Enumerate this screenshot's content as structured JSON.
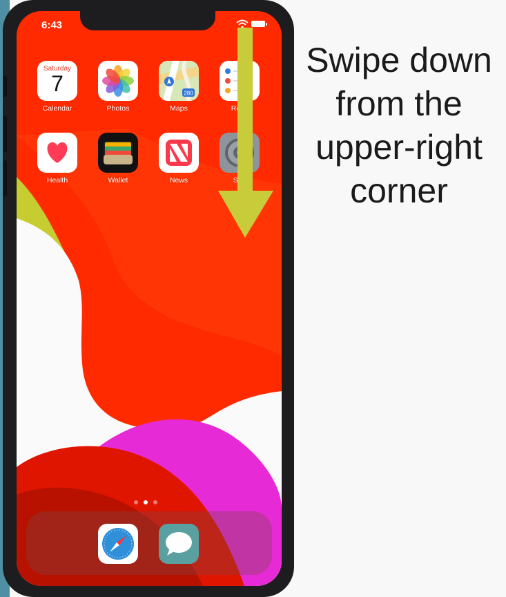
{
  "status_bar": {
    "time": "6:43"
  },
  "home_screen": {
    "row1": [
      {
        "label": "Calendar",
        "icon": "calendar-icon",
        "weekday": "Saturday",
        "date": "7"
      },
      {
        "label": "Photos",
        "icon": "photos-icon"
      },
      {
        "label": "Maps",
        "icon": "maps-icon",
        "route_number": "280"
      },
      {
        "label": "Remi",
        "icon": "reminders-icon"
      }
    ],
    "row2": [
      {
        "label": "Health",
        "icon": "health-icon"
      },
      {
        "label": "Wallet",
        "icon": "wallet-icon"
      },
      {
        "label": "News",
        "icon": "news-icon"
      },
      {
        "label": "Sett",
        "icon": "settings-icon"
      }
    ],
    "page_count": 3,
    "active_page": 2
  },
  "dock": [
    {
      "name": "Safari",
      "icon": "safari-icon"
    },
    {
      "name": "Messages",
      "icon": "messages-icon"
    }
  ],
  "annotation": {
    "lines": [
      "Swipe down",
      "from the",
      "upper-right",
      "corner"
    ],
    "arrow_color": "#c8cc3a"
  },
  "colors": {
    "wallpaper_red": "#ff2a00",
    "wallpaper_magenta": "#e62bd6",
    "wallpaper_yellow": "#c7cc30",
    "phone_frame": "#1d1d1f",
    "frame_teal": "#4e8fa4"
  }
}
